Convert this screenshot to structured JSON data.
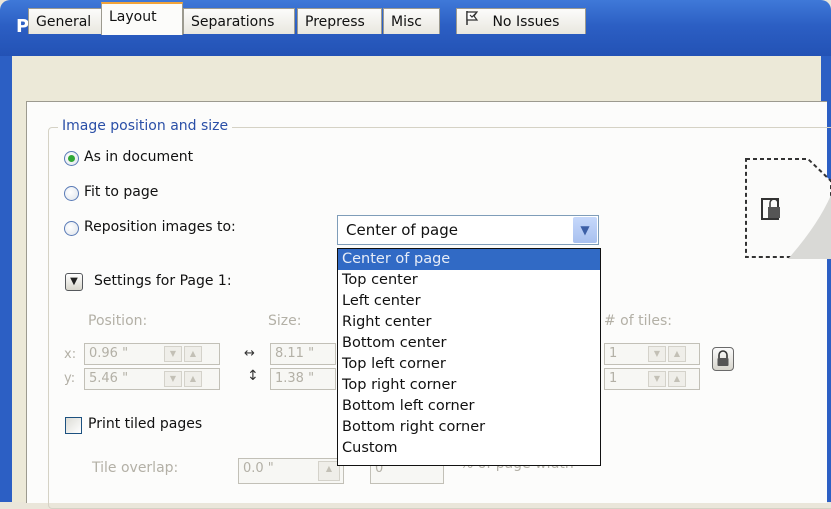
{
  "window": {
    "title": "Print"
  },
  "tabs": [
    {
      "label": "General"
    },
    {
      "label": "Layout"
    },
    {
      "label": "Separations"
    },
    {
      "label": "Prepress"
    },
    {
      "label": "Misc"
    },
    {
      "label": "No Issues",
      "icon": "issues-flag-icon"
    }
  ],
  "active_tab": "Layout",
  "image_position": {
    "group_label": "Image position and size",
    "options": [
      {
        "label": "As in document",
        "checked": true
      },
      {
        "label": "Fit to page",
        "checked": false
      },
      {
        "label": "Reposition images to:",
        "checked": false
      }
    ],
    "reposition_select": {
      "value": "Center of page",
      "options": [
        "Center of page",
        "Top center",
        "Left center",
        "Right center",
        "Bottom center",
        "Top left corner",
        "Top right corner",
        "Bottom left corner",
        "Bottom right corner",
        "Custom"
      ],
      "highlighted": "Center of page"
    }
  },
  "settings": {
    "label": "Settings for Page 1:",
    "position_label": "Position:",
    "size_label": "Size:",
    "tiles_label": "# of tiles:",
    "x_label": "x:",
    "y_label": "y:",
    "x_value": "0.96 \"",
    "y_value": "5.46 \"",
    "width_value": "8.11 \"",
    "height_value": "1.38 \"",
    "tiles_x": "1",
    "tiles_y": "1"
  },
  "tiling": {
    "print_tiled_label": "Print tiled pages",
    "print_tiled_checked": false,
    "overlap_label": "Tile overlap:",
    "overlap_value": "0.0 \"",
    "overlap_pct_value": "0",
    "page_width_label": "% of page width"
  },
  "colors": {
    "title_bar": "#2c5fc4",
    "selection": "#316ac5",
    "group_label": "#2a4fa7",
    "radio_checked": "#2fa836",
    "tab_active_top": "#f2a43a"
  }
}
